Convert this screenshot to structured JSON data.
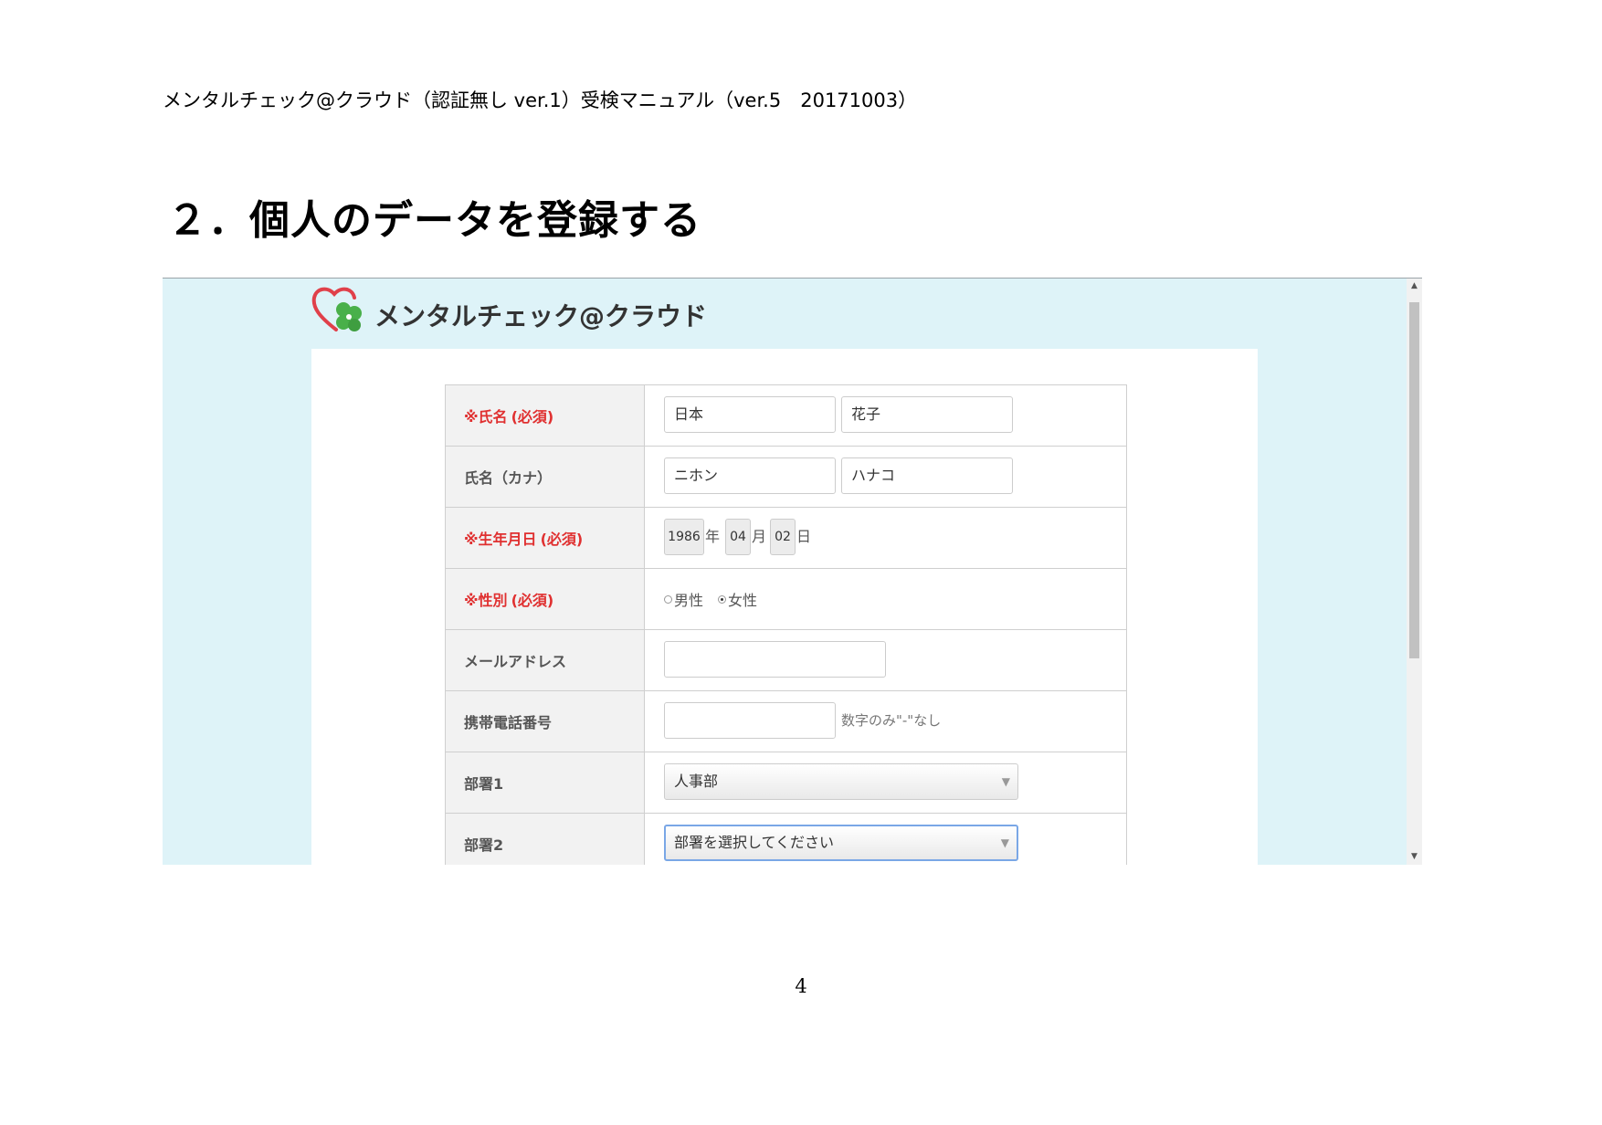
{
  "document": {
    "header": "メンタルチェック@クラウド（認証無し ver.1）受検マニュアル（ver.5　20171003）",
    "section_title": "２．個人のデータを登録する",
    "page_number": "4"
  },
  "app": {
    "logo_text": "メンタルチェック@クラウド",
    "colors": {
      "background": "#def3f8",
      "required": "#e03030",
      "heart": "#e0404a",
      "clover": "#49b04a"
    }
  },
  "form": {
    "name": {
      "label": "※氏名",
      "required": "(必須)",
      "last": "日本",
      "first": "花子"
    },
    "kana": {
      "label": "氏名（カナ）",
      "last": "ニホン",
      "first": "ハナコ"
    },
    "birth": {
      "label": "※生年月日",
      "required": "(必須)",
      "year": "1986",
      "year_unit": "年",
      "month": "04",
      "month_unit": "月",
      "day": "02",
      "day_unit": "日"
    },
    "gender": {
      "label": "※性別",
      "required": "(必須)",
      "options": [
        "男性",
        "女性"
      ],
      "selected": "女性"
    },
    "email": {
      "label": "メールアドレス",
      "value": ""
    },
    "phone": {
      "label": "携帯電話番号",
      "value": "",
      "hint": "数字のみ\"-\"なし"
    },
    "dept1": {
      "label": "部署1",
      "value": "人事部"
    },
    "dept2": {
      "label": "部署2",
      "value": "部署を選択してください"
    }
  },
  "icons": {
    "scroll_up": "up-arrow-icon",
    "scroll_down": "down-arrow-icon",
    "select_arrow": "chevron-down-icon"
  }
}
